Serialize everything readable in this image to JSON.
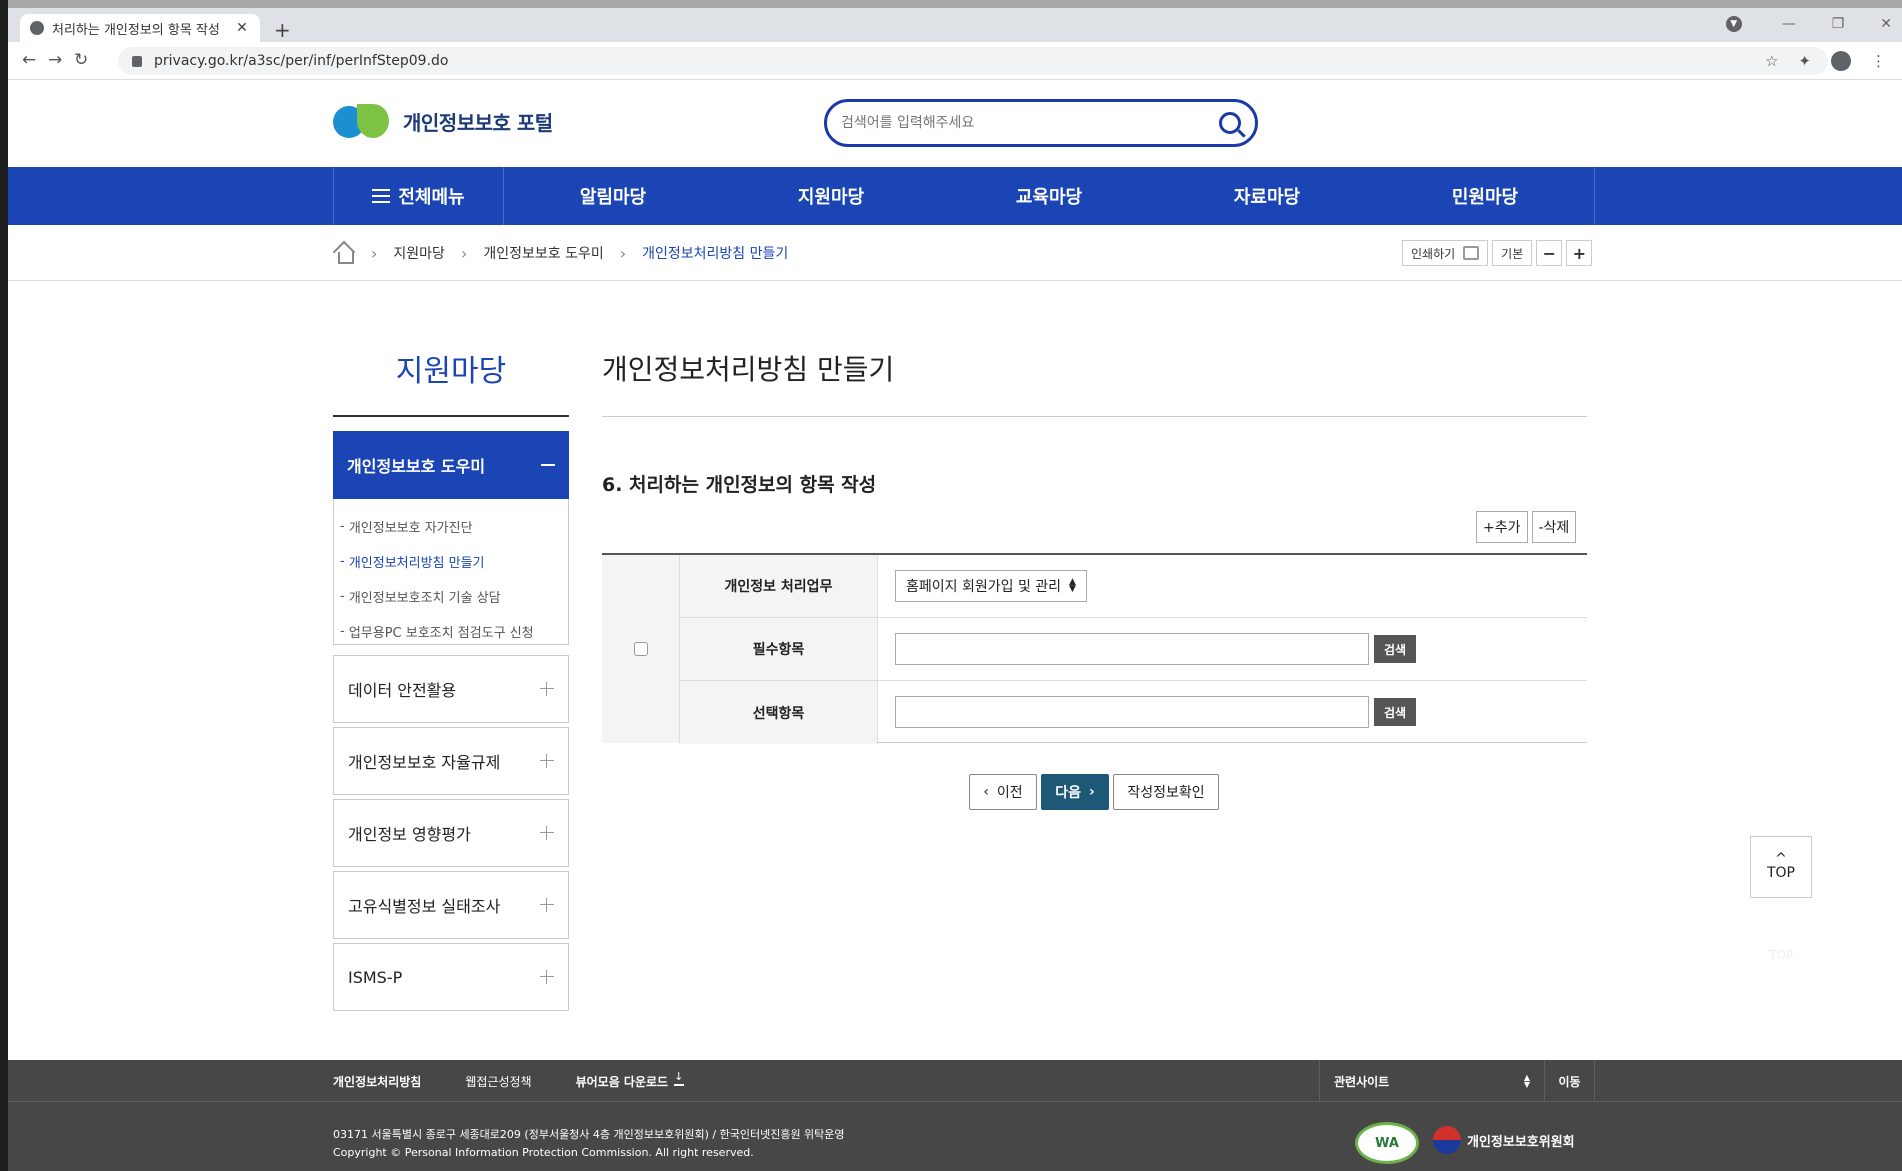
{
  "browser": {
    "tab_title": "처리하는 개인정보의 항목 작성",
    "url": "privacy.go.kr/a3sc/per/inf/perInfStep09.do"
  },
  "header": {
    "logo_text": "개인정보보호 포털",
    "search_placeholder": "검색어를 입력해주세요"
  },
  "gnb": {
    "all_menu": "전체메뉴",
    "items": [
      "알림마당",
      "지원마당",
      "교육마당",
      "자료마당",
      "민원마당"
    ]
  },
  "breadcrumb": {
    "items": [
      "지원마당",
      "개인정보보호 도우미",
      "개인정보처리방침 만들기"
    ],
    "tools": {
      "print": "인쇄하기",
      "default": "기본",
      "minus": "−",
      "plus": "+"
    }
  },
  "sidebar": {
    "title": "지원마당",
    "active": "개인정보보호 도우미",
    "sub_items": [
      "개인정보보호 자가진단",
      "개인정보처리방침 만들기",
      "개인정보보호조치 기술 상담",
      "업무용PC 보호조치 점검도구 신청"
    ],
    "items": [
      "데이터 안전활용",
      "개인정보보호 자율규제",
      "개인정보 영향평가",
      "고유식별정보 실태조사",
      "ISMS-P"
    ]
  },
  "main": {
    "title": "개인정보처리방침 만들기",
    "section_title": "6. 처리하는 개인정보의 항목 작성",
    "add_label": "+추가",
    "delete_label": "-삭제",
    "form": {
      "task_label": "개인정보 처리업무",
      "task_value": "홈페이지 회원가입 및 관리",
      "required_label": "필수항목",
      "optional_label": "선택항목",
      "search_label": "검색"
    },
    "prev_label": "이전",
    "next_label": "다음",
    "confirm_label": "작성정보확인"
  },
  "top_button": "TOP",
  "footer": {
    "links": [
      "개인정보처리방침",
      "웹접근성정책",
      "뷰어모음 다운로드"
    ],
    "related_label": "관련사이트",
    "go_label": "이동",
    "address": "03171 서울특별시 종로구 세종대로209 (정부서울청사 4층 개인정보보호위원회) / 한국인터넷진흥원 위탁운영",
    "copyright": "Copyright © Personal Information Protection Commission. All right reserved.",
    "wa_mark": "WA",
    "commission": "개인정보보호위원회"
  }
}
